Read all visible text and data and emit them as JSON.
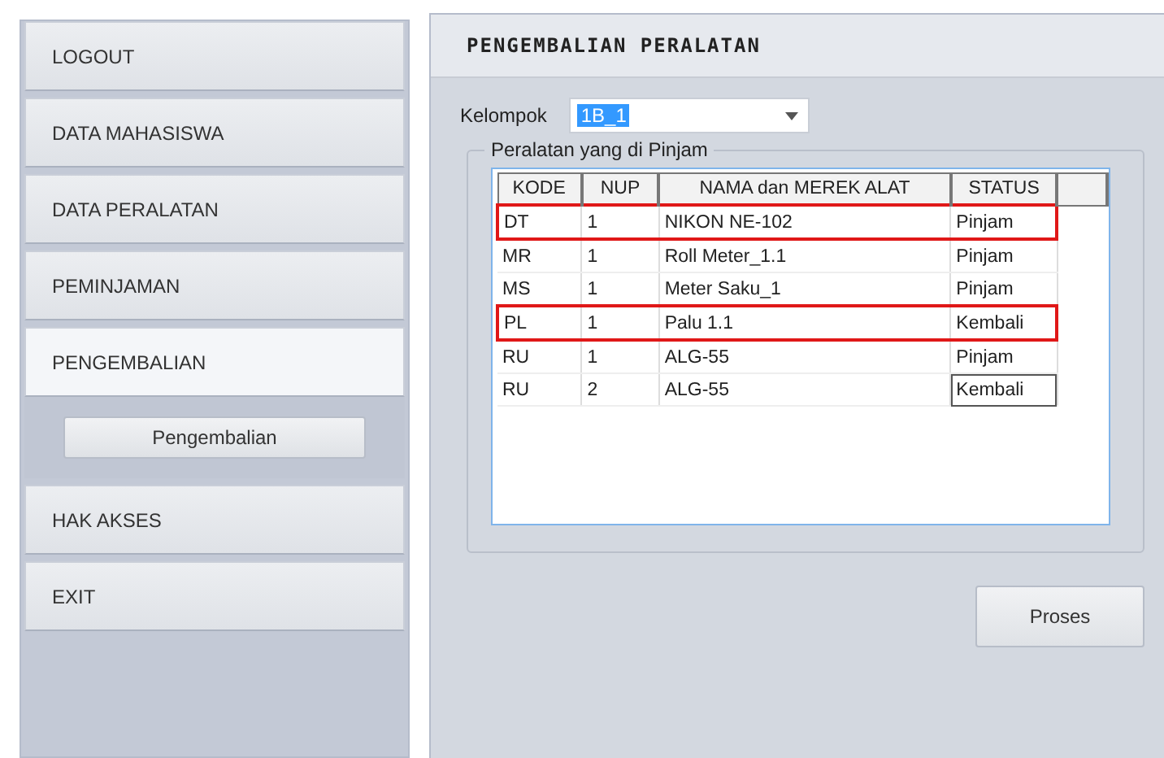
{
  "sidebar": {
    "items": [
      {
        "label": "LOGOUT",
        "selected": false
      },
      {
        "label": "DATA MAHASISWA",
        "selected": false
      },
      {
        "label": "DATA PERALATAN",
        "selected": false
      },
      {
        "label": "PEMINJAMAN",
        "selected": false
      },
      {
        "label": "PENGEMBALIAN",
        "selected": true,
        "children": [
          {
            "label": "Pengembalian"
          }
        ]
      },
      {
        "label": "HAK AKSES",
        "selected": false
      },
      {
        "label": "EXIT",
        "selected": false
      }
    ]
  },
  "panel": {
    "title": "PENGEMBALIAN PERALATAN",
    "kelompok": {
      "label": "Kelompok",
      "value": "1B_1",
      "text_selected": true
    },
    "group": {
      "title": "Peralatan yang di Pinjam",
      "table": {
        "columns": [
          "KODE",
          "NUP",
          "NAMA dan MEREK ALAT",
          "STATUS"
        ],
        "rows": [
          {
            "cells": [
              "DT",
              "1",
              "NIKON NE-102",
              "Pinjam"
            ],
            "highlighted": true,
            "focused": false
          },
          {
            "cells": [
              "MR",
              "1",
              "Roll Meter_1.1",
              "Pinjam"
            ],
            "highlighted": false,
            "focused": false
          },
          {
            "cells": [
              "MS",
              "1",
              "Meter Saku_1",
              "Pinjam"
            ],
            "highlighted": false,
            "focused": false
          },
          {
            "cells": [
              "PL",
              "1",
              "Palu 1.1",
              "Kembali"
            ],
            "highlighted": true,
            "focused": false
          },
          {
            "cells": [
              "RU",
              "1",
              "ALG-55",
              "Pinjam"
            ],
            "highlighted": false,
            "focused": false
          },
          {
            "cells": [
              "RU",
              "2",
              "ALG-55",
              "Kembali"
            ],
            "highlighted": false,
            "focused": true
          }
        ]
      }
    },
    "button": "Proses"
  }
}
